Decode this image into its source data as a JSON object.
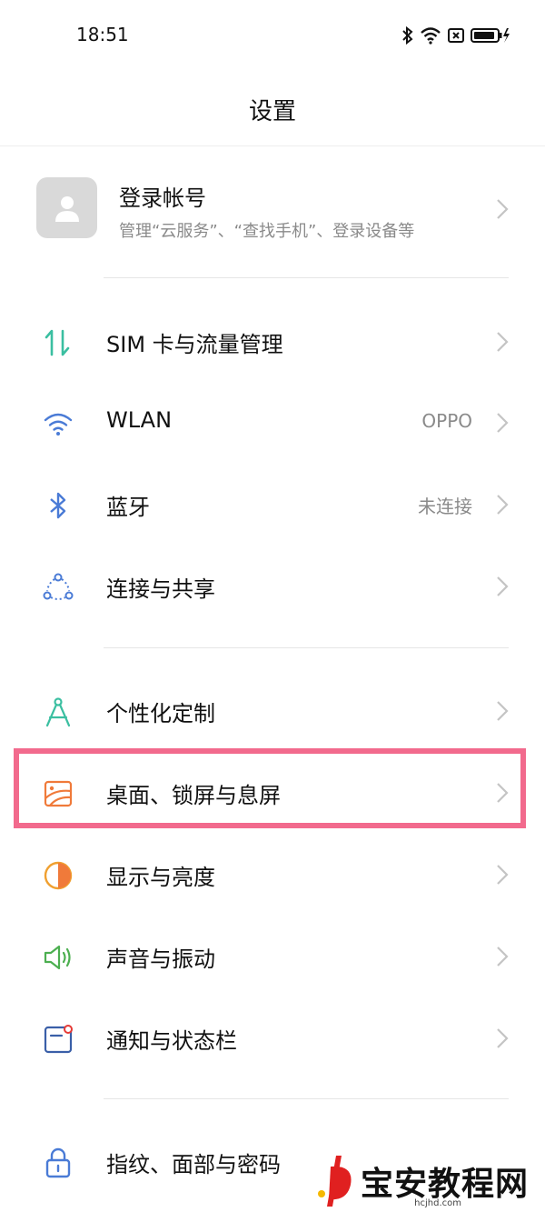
{
  "status_bar": {
    "time": "18:51"
  },
  "header": {
    "title": "设置"
  },
  "account": {
    "title": "登录帐号",
    "subtitle": "管理“云服务”、“查找手机”、登录设备等"
  },
  "items": [
    {
      "label": "SIM 卡与流量管理",
      "value": "",
      "icon": "sim-data-icon"
    },
    {
      "label": "WLAN",
      "value": "OPPO",
      "icon": "wifi-icon"
    },
    {
      "label": "蓝牙",
      "value": "未连接",
      "icon": "bluetooth-icon"
    },
    {
      "label": "连接与共享",
      "value": "",
      "icon": "connection-share-icon"
    },
    {
      "label": "个性化定制",
      "value": "",
      "icon": "personalization-icon"
    },
    {
      "label": "桌面、锁屏与息屏",
      "value": "",
      "icon": "wallpaper-icon"
    },
    {
      "label": "显示与亮度",
      "value": "",
      "icon": "display-brightness-icon"
    },
    {
      "label": "声音与振动",
      "value": "",
      "icon": "sound-icon"
    },
    {
      "label": "通知与状态栏",
      "value": "",
      "icon": "notification-icon"
    },
    {
      "label": "指纹、面部与密码",
      "value": "",
      "icon": "lock-icon"
    }
  ],
  "watermark": {
    "text": "宝安教程网",
    "url": "hcjhd.com"
  },
  "colors": {
    "highlight": "#f26a8d",
    "teal": "#3bbfa1",
    "blue": "#4a7bd6",
    "orange": "#f07a3a",
    "green": "#4caf50"
  }
}
